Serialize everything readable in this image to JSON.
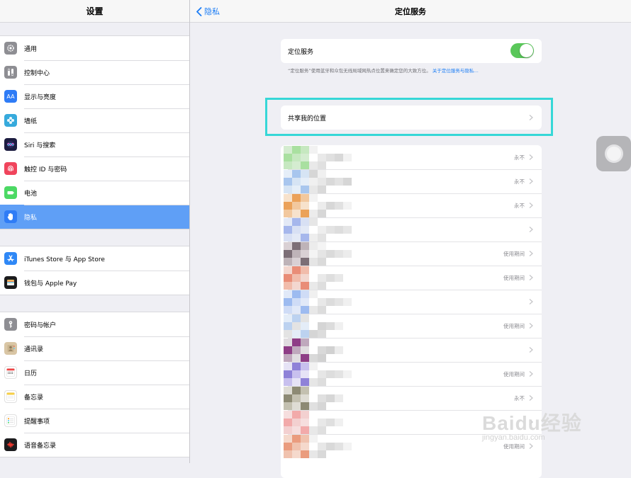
{
  "sidebar": {
    "title": "设置",
    "groups": [
      [
        {
          "label": "通用",
          "icon": "gear-icon",
          "color": "#8e8e93"
        },
        {
          "label": "控制中心",
          "icon": "switches-icon",
          "color": "#8e8e93"
        },
        {
          "label": "显示与亮度",
          "icon": "text-size-icon",
          "color": "#2f7cf6"
        },
        {
          "label": "墙纸",
          "icon": "flower-icon",
          "color": "#36aadc"
        },
        {
          "label": "Siri 与搜索",
          "icon": "siri-icon",
          "color": "#1c1c40"
        },
        {
          "label": "触控 ID 与密码",
          "icon": "fingerprint-icon",
          "color": "#f0445c"
        },
        {
          "label": "电池",
          "icon": "battery-icon",
          "color": "#4cd964"
        },
        {
          "label": "隐私",
          "icon": "hand-icon",
          "color": "#2f7cf6",
          "selected": true
        }
      ],
      [
        {
          "label": "iTunes Store 与 App Store",
          "icon": "app-store-icon",
          "color": "#2f88f6"
        },
        {
          "label": "钱包与 Apple Pay",
          "icon": "wallet-icon",
          "color": "#1c1c1e"
        }
      ],
      [
        {
          "label": "密码与帐户",
          "icon": "key-icon",
          "color": "#8e8e93"
        },
        {
          "label": "通讯录",
          "icon": "contacts-icon",
          "color": "#d9c6a5"
        },
        {
          "label": "日历",
          "icon": "calendar-icon",
          "color": "#ffffff"
        },
        {
          "label": "备忘录",
          "icon": "notes-icon",
          "color": "#ffffff"
        },
        {
          "label": "提醒事项",
          "icon": "reminders-icon",
          "color": "#ffffff"
        },
        {
          "label": "语音备忘录",
          "icon": "voice-memo-icon",
          "color": "#1c1c1e"
        }
      ]
    ]
  },
  "header": {
    "back_label": "隐私",
    "title": "定位服务"
  },
  "location": {
    "label": "定位服务",
    "toggle_on": true,
    "footnote": "“定位服务”使用蓝牙和众包无线局域网热点位置来确定您的大致方位。",
    "footnote_link": "关于定位服务与隐私…"
  },
  "share": {
    "label": "共享我的位置"
  },
  "apps": [
    {
      "status": "永不",
      "colors": [
        "#d4ecd0",
        "#a9e0a0",
        "#c6e8c0",
        "#e9e9e9",
        "#e0e0e0",
        "#d8d8d8",
        "#f2f2f2",
        "#ffffff"
      ]
    },
    {
      "status": "永不",
      "colors": [
        "#e5eef8",
        "#a8c6ee",
        "#d6e4f4",
        "#e7e7e7",
        "#d9d9d9",
        "#e2e2e2",
        "#d6d6d6",
        "#f0f0f0"
      ]
    },
    {
      "status": "永不",
      "colors": [
        "#f7e2cc",
        "#eba25a",
        "#f2c89e",
        "#ececec",
        "#d7d7d7",
        "#e1e1e1",
        "#f3f3f3",
        "#ffffff"
      ]
    },
    {
      "status": "",
      "colors": [
        "#e3e9f6",
        "#a6b7ec",
        "#d8e0f4",
        "#eeeeee",
        "#e3e3e3",
        "#dddddd",
        "#e6e6e6",
        "#ffffff"
      ]
    },
    {
      "status": "使用期间",
      "colors": [
        "#d9d0d4",
        "#7c6e76",
        "#beb3b8",
        "#e5e5e5",
        "#dadada",
        "#e4e4e4",
        "#ececec",
        "#f4f4f4"
      ]
    },
    {
      "status": "使用期间",
      "colors": [
        "#f3d7cf",
        "#e98d77",
        "#f1bcab",
        "#e9e9e9",
        "#dedede",
        "#e8e8e8",
        "#ffffff",
        "#ffffff"
      ]
    },
    {
      "status": "",
      "colors": [
        "#e1e9f8",
        "#9dbbf0",
        "#cfdcf6",
        "#e8e8e8",
        "#dcdcdc",
        "#e4e4e4",
        "#f0f0f0",
        "#ffffff"
      ]
    },
    {
      "status": "使用期间",
      "colors": [
        "#e4edf8",
        "#bcd2f0",
        "#e3e3e3",
        "#d5d5d5",
        "#dcdcdc",
        "#f0f0f0",
        "#ffffff",
        "#ffffff"
      ]
    },
    {
      "status": "",
      "colors": [
        "#e0dce0",
        "#8e3d86",
        "#bfa8bd",
        "#d9d9d9",
        "#d1d1d1",
        "#ececec",
        "#ffffff",
        "#ffffff"
      ]
    },
    {
      "status": "使用期间",
      "colors": [
        "#e6e3f6",
        "#8f82d8",
        "#c8c0ee",
        "#e6e6e6",
        "#dddddd",
        "#e3e3e3",
        "#f2f2f2",
        "#ffffff"
      ]
    },
    {
      "status": "永不",
      "colors": [
        "#dedcd4",
        "#8d8a74",
        "#c3c0b0",
        "#e0e0e0",
        "#d6d6d6",
        "#ebebeb",
        "#ffffff",
        "#ffffff"
      ]
    },
    {
      "status": "",
      "colors": [
        "#f6dede",
        "#f2aaaa",
        "#f3d0d0",
        "#e8e8e8",
        "#dfdfdf",
        "#f0f0f0",
        "#ffffff",
        "#ffffff"
      ]
    },
    {
      "status": "使用期间",
      "colors": [
        "#f5d9cc",
        "#ea9c7e",
        "#f0c2ae",
        "#e7e7e7",
        "#d9d9d9",
        "#e2e2e2",
        "#f3f3f3",
        "#ffffff"
      ]
    }
  ],
  "watermark": {
    "main": "Baidu经验",
    "sub": "jingyan.baidu.com"
  },
  "colors": {
    "accent": "#1a7cf5",
    "selected_row": "#5f9ff6",
    "toggle_on": "#5ac75a",
    "highlight_box": "#36d7d7"
  }
}
